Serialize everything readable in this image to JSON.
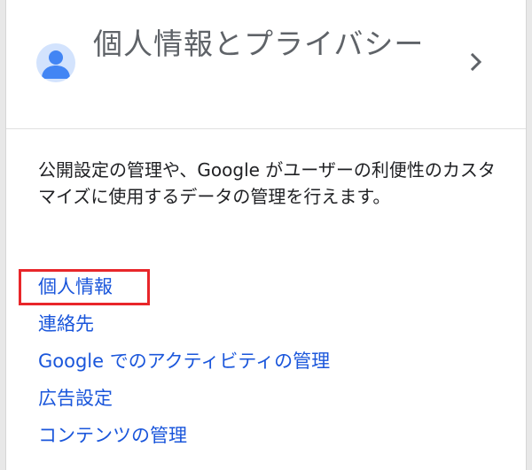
{
  "card": {
    "title": "個人情報とプライバシー",
    "icon": "avatar-person-icon",
    "chevron_icon": "chevron-right-icon",
    "description": "公開設定の管理や、Google がユーザーの利便性のカスタマイズに使用するデータの管理を行えます。",
    "links": [
      {
        "label": "個人情報"
      },
      {
        "label": "連絡先"
      },
      {
        "label": "Google でのアクティビティの管理"
      },
      {
        "label": "広告設定"
      },
      {
        "label": "コンテンツの管理"
      }
    ]
  },
  "colors": {
    "link": "#1a56db",
    "title": "#5f6368",
    "avatar_bg": "#d3e3fd",
    "avatar_fg": "#4285f4",
    "highlight": "#e8262a"
  }
}
